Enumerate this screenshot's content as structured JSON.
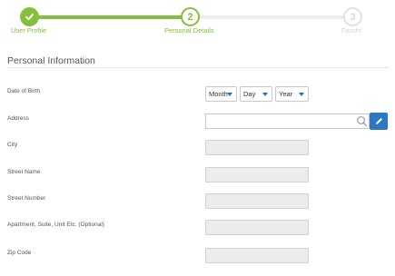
{
  "stepper": {
    "steps": [
      {
        "number": "",
        "label": "User Profile",
        "state": "complete"
      },
      {
        "number": "2",
        "label": "Personal Details",
        "state": "current"
      },
      {
        "number": "3",
        "label": "Finish!",
        "state": "upcoming"
      }
    ],
    "colors": {
      "active": "#86bf3b",
      "inactive": "#ececec"
    }
  },
  "section": {
    "title": "Personal Information"
  },
  "form": {
    "date_of_birth": {
      "label": "Date of Birth",
      "month": "Month",
      "day": "Day",
      "year": "Year"
    },
    "address": {
      "label": "Address",
      "value": ""
    },
    "city": {
      "label": "City",
      "value": ""
    },
    "street_name": {
      "label": "Street Name",
      "value": ""
    },
    "street_number": {
      "label": "Street Number",
      "value": ""
    },
    "apartment": {
      "label": "Apartment, Suite, Unit Etc. (Optional)",
      "value": ""
    },
    "zip_code": {
      "label": "Zip Code",
      "value": ""
    }
  },
  "icons": {
    "search": "search-icon",
    "edit": "pencil-icon",
    "check": "check-icon"
  },
  "accent_color": "#2a78c2"
}
